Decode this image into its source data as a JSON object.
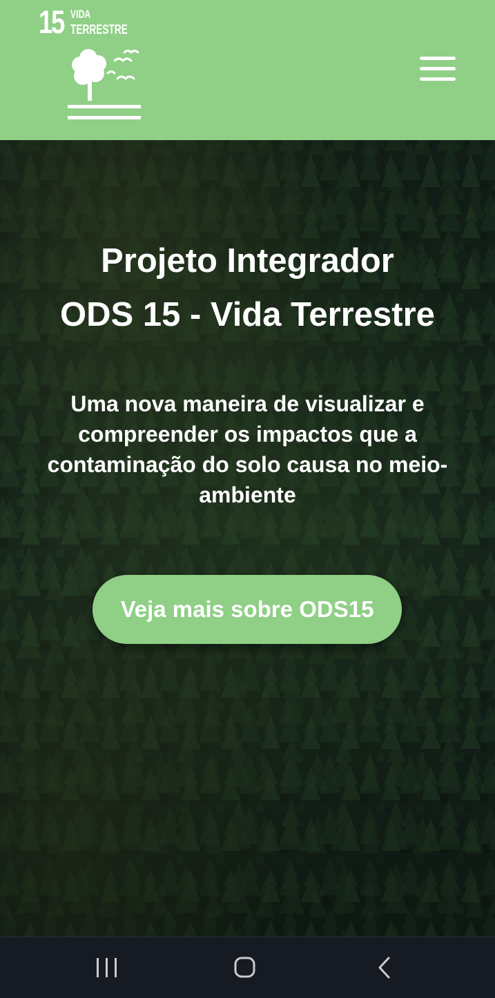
{
  "header": {
    "logo": {
      "number": "15",
      "line1": "VIDA",
      "line2": "TERRESTRE",
      "icon": "tree-birds-icon"
    },
    "menu_icon": "hamburger-menu-icon",
    "background_color": "#8fcf86"
  },
  "hero": {
    "title_line1": "Projeto Integrador",
    "title_line2": "ODS 15 - Vida Terrestre",
    "subtitle": "Uma nova maneira de visualizar e compreender os impactos que a contaminação do solo causa no meio-ambiente",
    "cta_label": "Veja mais sobre ODS15",
    "cta_color": "#8fcf86",
    "background": "forest-aerial-image"
  },
  "system_nav": {
    "recent_icon": "recent-apps-icon",
    "home_icon": "home-icon",
    "back_icon": "back-chevron-icon"
  }
}
